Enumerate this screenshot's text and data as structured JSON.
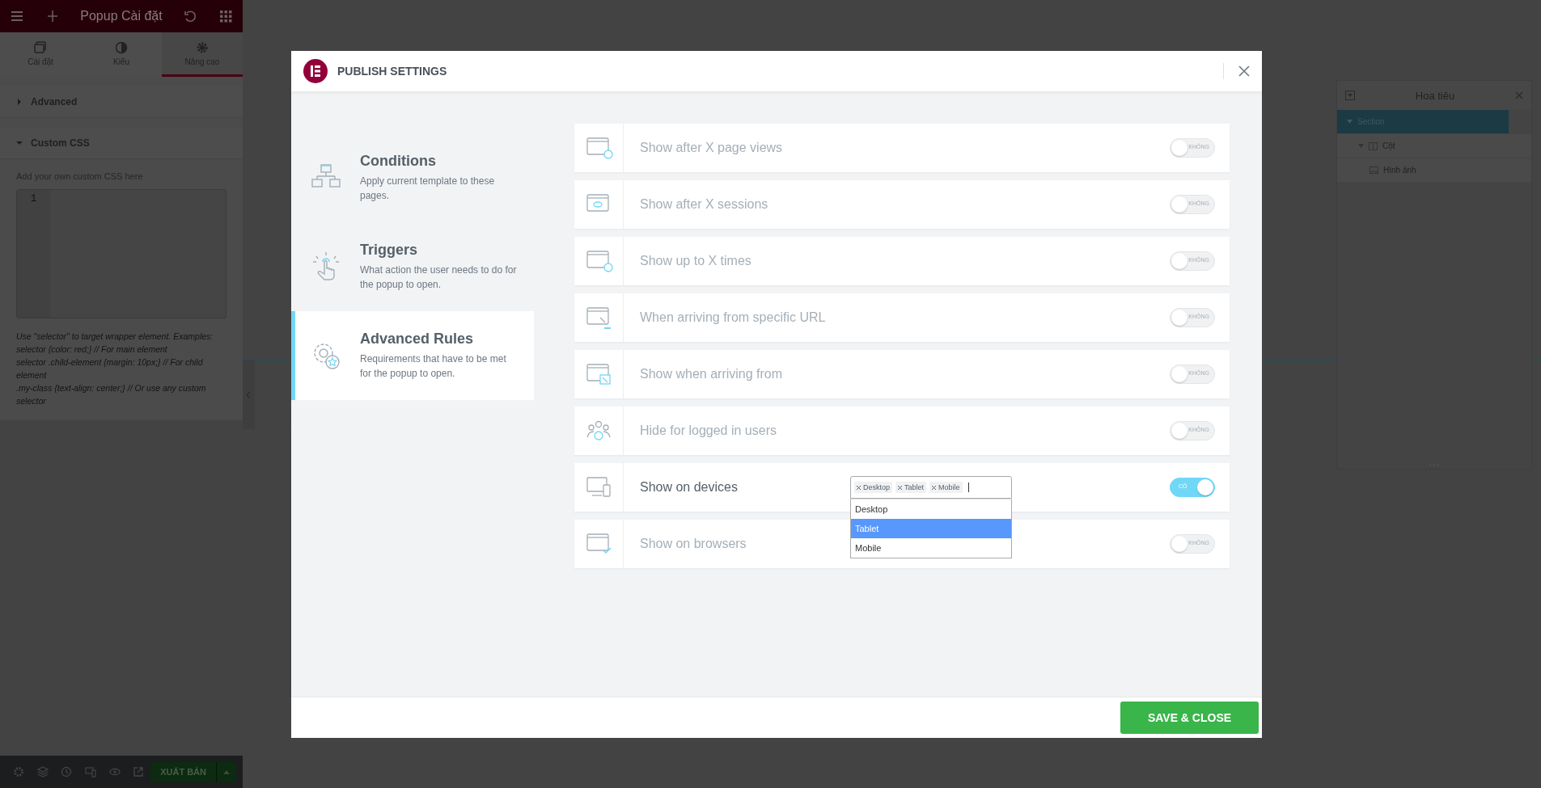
{
  "editor_panel": {
    "title": "Popup Cài đặt",
    "tabs": [
      {
        "label": "Cài đặt",
        "selected": false
      },
      {
        "label": "Kiểu",
        "selected": false
      },
      {
        "label": "Nâng cao",
        "selected": true
      }
    ],
    "sections": [
      {
        "title": "Advanced",
        "expanded": false
      },
      {
        "title": "Custom CSS",
        "expanded": true
      }
    ],
    "css_hint": "Add your own custom CSS here",
    "code_editor": {
      "line_numbers": [
        "1"
      ]
    },
    "help_lines": [
      "Use \"selector\" to target wrapper element. Examples:",
      "selector {color: red;} // For main element",
      "selector .child-element {margin: 10px;} // For child element",
      ".my-class {text-align: center;} // Or use any custom selector"
    ]
  },
  "bottom_bar": {
    "publish_button": "XUẤT BẢN"
  },
  "navigator": {
    "title": "Hoa tiêu",
    "tree": [
      {
        "label": "Section",
        "selected": true,
        "expanded": true,
        "children": [
          {
            "label": "Cột",
            "selected": false,
            "expanded": true,
            "children": [
              {
                "label": "Hình ảnh",
                "selected": false
              }
            ]
          }
        ]
      }
    ]
  },
  "modal": {
    "title": "PUBLISH SETTINGS",
    "nav": [
      {
        "title": "Conditions",
        "description": "Apply current template to these pages.",
        "selected": false
      },
      {
        "title": "Triggers",
        "description": "What action the user needs to do for the popup to open.",
        "selected": false
      },
      {
        "title": "Advanced Rules",
        "description": "Requirements that have to be met for the popup to open.",
        "selected": true
      }
    ],
    "rules": [
      {
        "label": "Show after X page views",
        "on": false,
        "toggle_label": "KHÔNG"
      },
      {
        "label": "Show after X sessions",
        "on": false,
        "toggle_label": "KHÔNG"
      },
      {
        "label": "Show up to X times",
        "on": false,
        "toggle_label": "KHÔNG"
      },
      {
        "label": "When arriving from specific URL",
        "on": false,
        "toggle_label": "KHÔNG"
      },
      {
        "label": "Show when arriving from",
        "on": false,
        "toggle_label": "KHÔNG"
      },
      {
        "label": "Hide for logged in users",
        "on": false,
        "toggle_label": "KHÔNG"
      },
      {
        "label": "Show on devices",
        "on": true,
        "toggle_label": "CÓ",
        "select": {
          "tags": [
            "Desktop",
            "Tablet",
            "Mobile"
          ],
          "options": [
            {
              "label": "Desktop",
              "selected": false
            },
            {
              "label": "Tablet",
              "selected": true
            },
            {
              "label": "Mobile",
              "selected": false
            }
          ]
        }
      },
      {
        "label": "Show on browsers",
        "on": false,
        "toggle_label": "KHÔNG"
      }
    ],
    "save_button": "SAVE & CLOSE"
  }
}
